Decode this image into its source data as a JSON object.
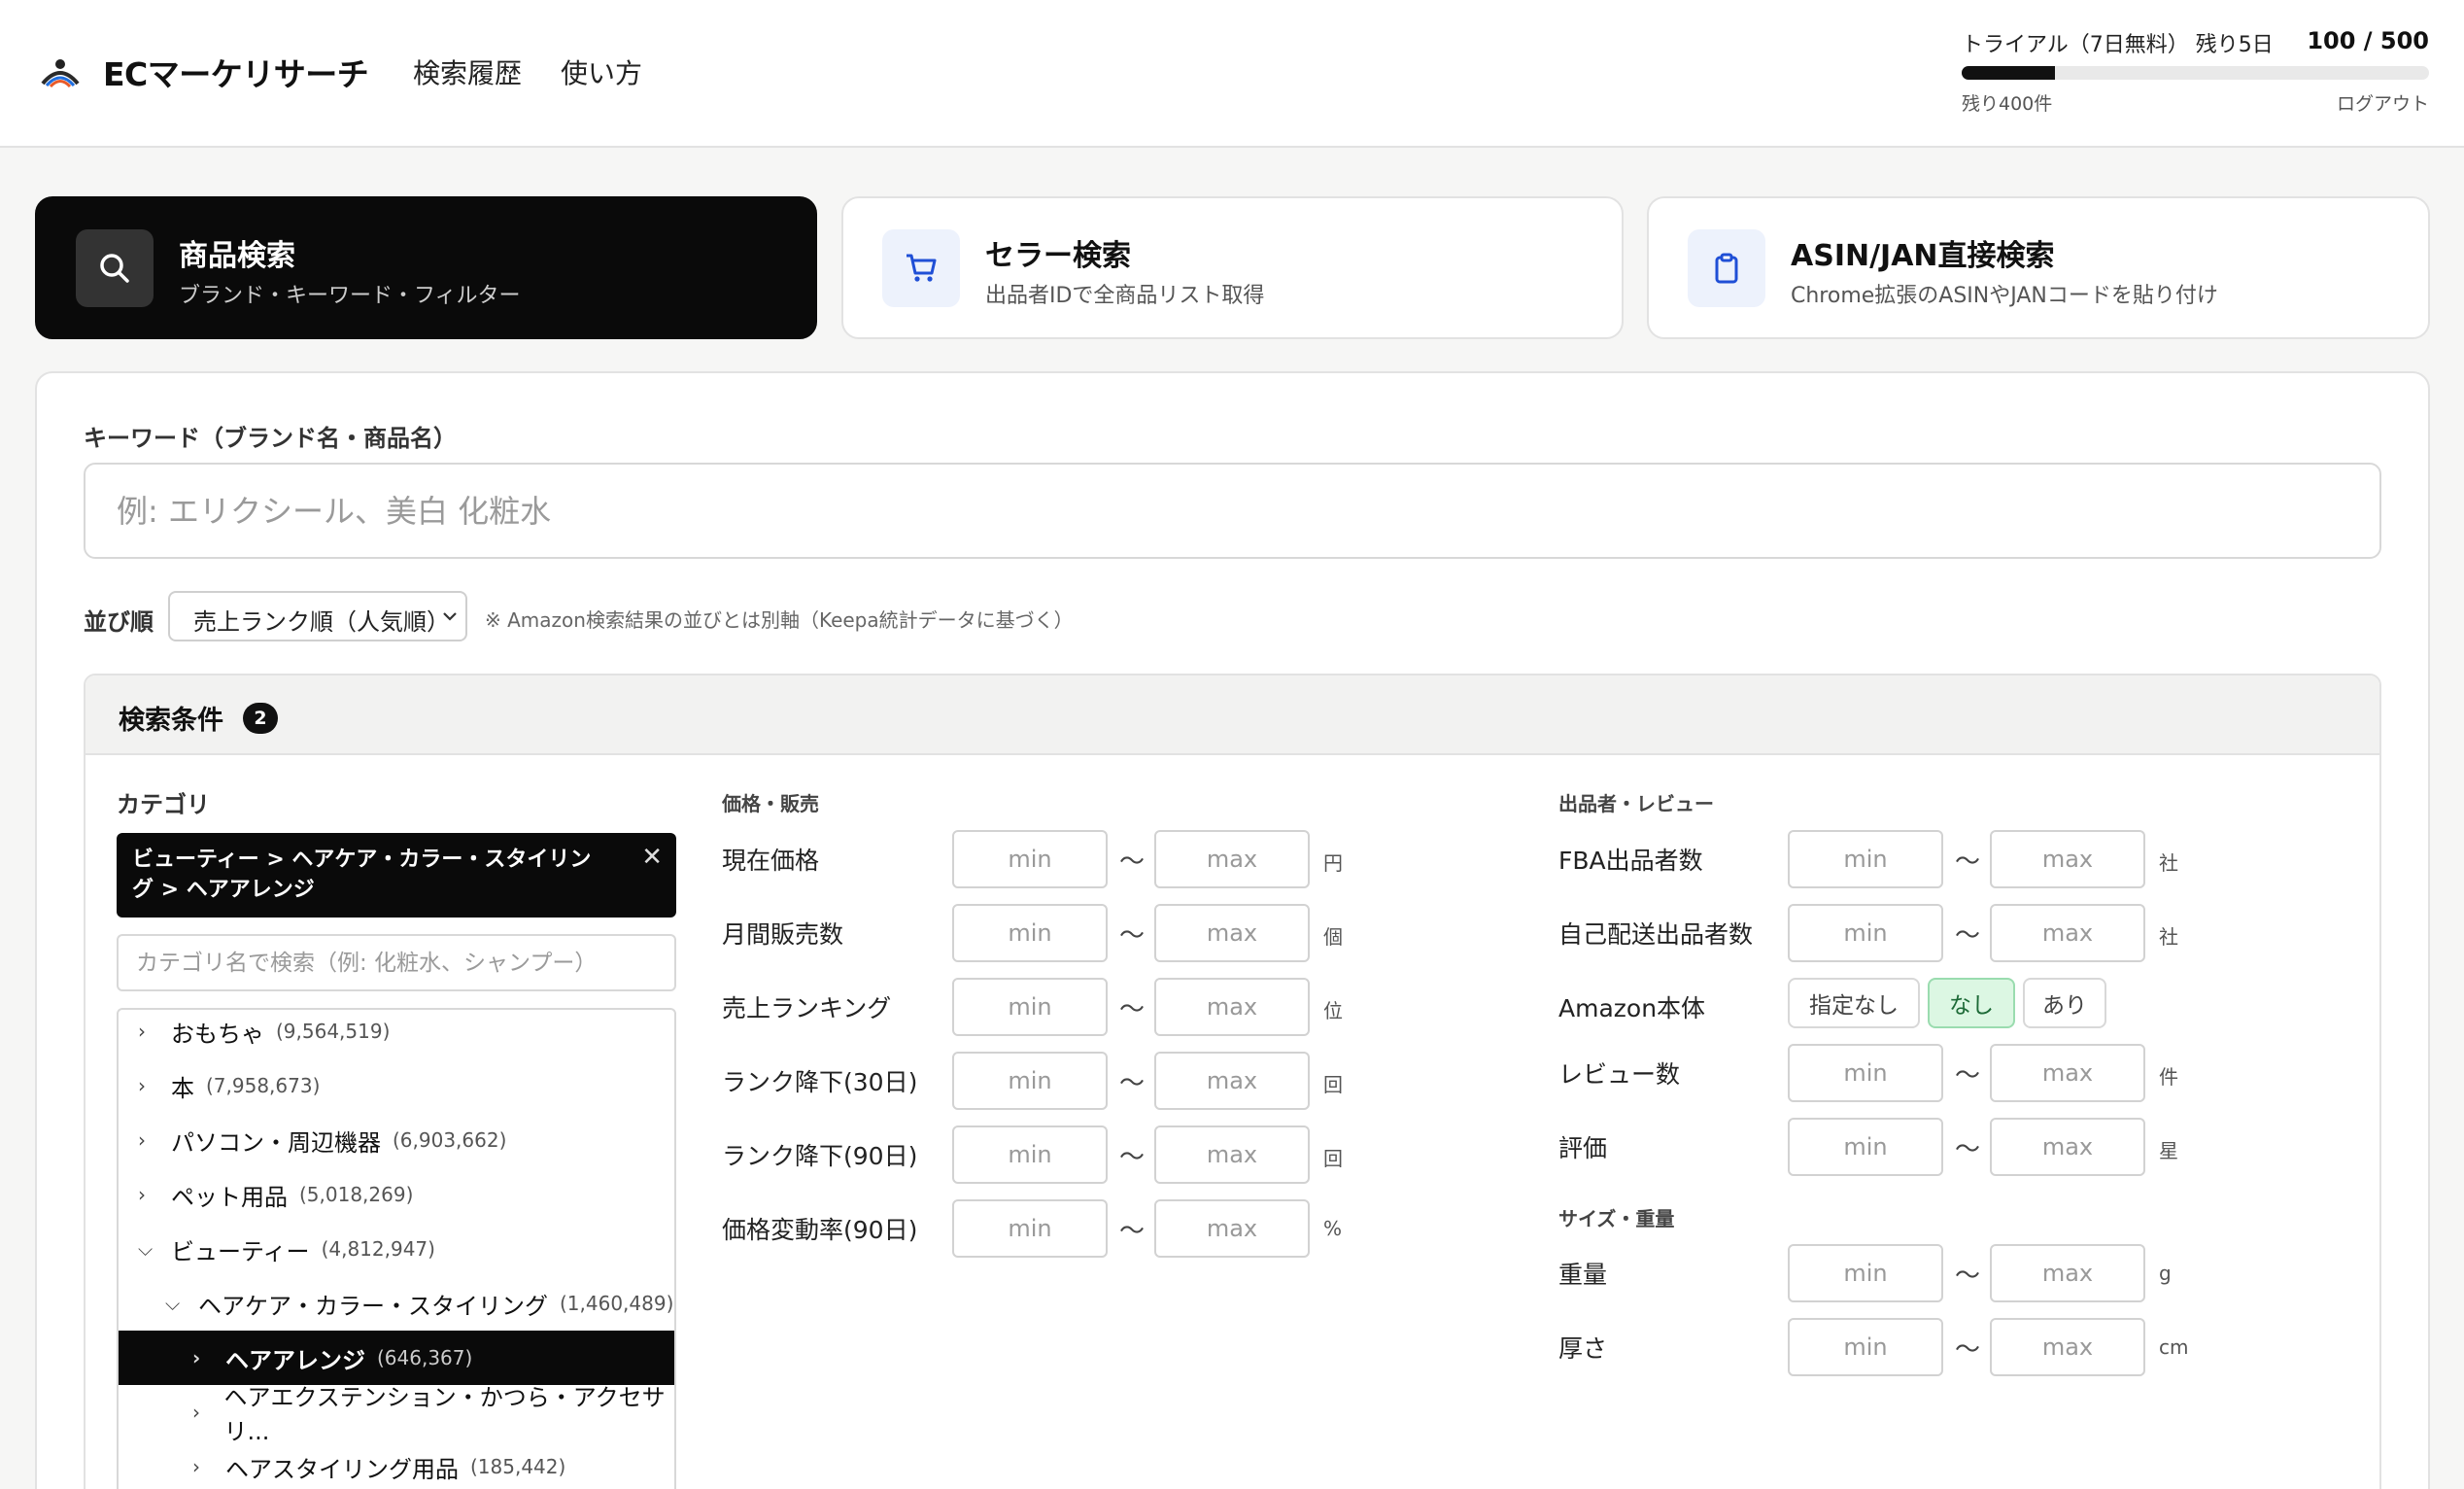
{
  "header": {
    "app_title": "ECマーケリサーチ",
    "nav": [
      "検索履歴",
      "使い方"
    ],
    "trial_text": "トライアル（7日無料） 残り5日",
    "usage_count": "100 / 500",
    "usage_fraction": 0.2,
    "remaining_text": "残り400件",
    "logout": "ログアウト"
  },
  "modes": [
    {
      "title": "商品検索",
      "subtitle": "ブランド・キーワード・フィルター",
      "icon": "search-icon",
      "active": true
    },
    {
      "title": "セラー検索",
      "subtitle": "出品者IDで全商品リスト取得",
      "icon": "cart-icon",
      "active": false
    },
    {
      "title": "ASIN/JAN直接検索",
      "subtitle": "Chrome拡張のASINやJANコードを貼り付け",
      "icon": "clipboard-icon",
      "active": false
    }
  ],
  "keyword": {
    "label": "キーワード（ブランド名・商品名）",
    "placeholder": "例: エリクシール、美白 化粧水",
    "value": ""
  },
  "sort": {
    "label": "並び順",
    "selected": "売上ランク順（人気順）",
    "note": "※ Amazon検索結果の並びとは別軸（Keepa統計データに基づく）"
  },
  "conditions": {
    "title": "検索条件",
    "count": "2",
    "category": {
      "label": "カテゴリ",
      "selected_chip": "ビューティー > ヘアケア・カラー・スタイリング > ヘアアレンジ",
      "search_placeholder": "カテゴリ名で検索（例: 化粧水、シャンプー）",
      "tree": [
        {
          "name": "おもちゃ",
          "count": "(9,564,519)",
          "expanded": false,
          "depth": 0,
          "selected": false
        },
        {
          "name": "本",
          "count": "(7,958,673)",
          "expanded": false,
          "depth": 0,
          "selected": false
        },
        {
          "name": "パソコン・周辺機器",
          "count": "(6,903,662)",
          "expanded": false,
          "depth": 0,
          "selected": false
        },
        {
          "name": "ペット用品",
          "count": "(5,018,269)",
          "expanded": false,
          "depth": 0,
          "selected": false
        },
        {
          "name": "ビューティー",
          "count": "(4,812,947)",
          "expanded": true,
          "depth": 0,
          "selected": false
        },
        {
          "name": "ヘアケア・カラー・スタイリング",
          "count": "(1,460,489)",
          "expanded": true,
          "depth": 1,
          "selected": false
        },
        {
          "name": "ヘアアレンジ",
          "count": "(646,367)",
          "expanded": false,
          "depth": 2,
          "selected": true
        },
        {
          "name": "ヘアエクステンション・かつら・アクセサリ...",
          "count": "",
          "expanded": false,
          "depth": 2,
          "selected": false
        },
        {
          "name": "ヘアスタイリング用品",
          "count": "(185,442)",
          "expanded": false,
          "depth": 2,
          "selected": false
        }
      ]
    },
    "price_sales": {
      "title": "価格・販売",
      "rows": [
        {
          "label": "現在価格",
          "unit": "円"
        },
        {
          "label": "月間販売数",
          "unit": "個"
        },
        {
          "label": "売上ランキング",
          "unit": "位"
        },
        {
          "label": "ランク降下(30日)",
          "unit": "回"
        },
        {
          "label": "ランク降下(90日)",
          "unit": "回"
        },
        {
          "label": "価格変動率(90日)",
          "unit": "%"
        }
      ]
    },
    "seller_review": {
      "title": "出品者・レビュー",
      "rows": [
        {
          "label": "FBA出品者数",
          "unit": "社"
        },
        {
          "label": "自己配送出品者数",
          "unit": "社"
        },
        {
          "label": "レビュー数",
          "unit": "件"
        },
        {
          "label": "評価",
          "unit": "星"
        }
      ],
      "amazon": {
        "label": "Amazon本体",
        "options": [
          "指定なし",
          "なし",
          "あり"
        ],
        "selected": "なし"
      }
    },
    "size_weight": {
      "title": "サイズ・重量",
      "rows": [
        {
          "label": "重量",
          "unit": "g"
        },
        {
          "label": "厚さ",
          "unit": "cm"
        }
      ]
    },
    "placeholders": {
      "min": "min",
      "max": "max",
      "tilde": "〜"
    }
  }
}
